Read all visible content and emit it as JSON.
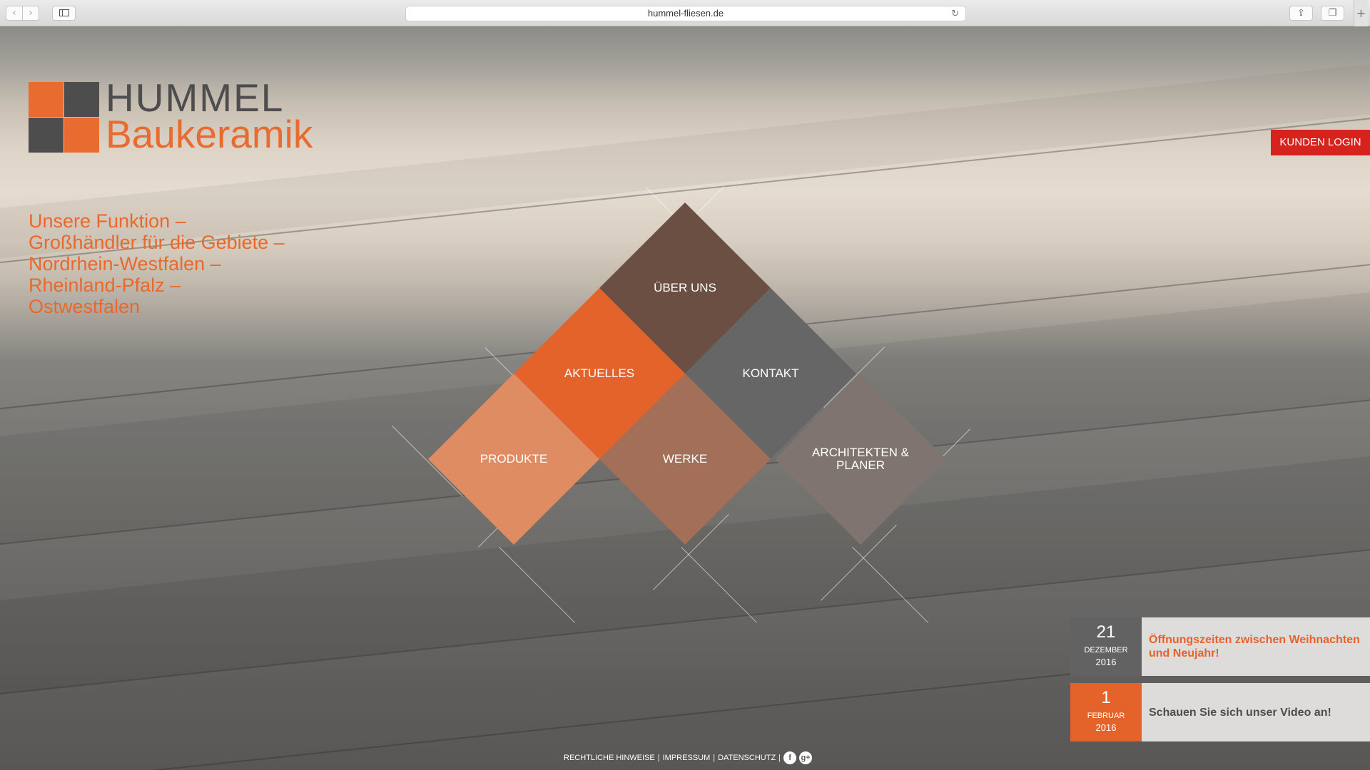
{
  "browser": {
    "url": "hummel-fliesen.de",
    "back_icon": "chevron-left-icon",
    "forward_icon": "chevron-right-icon",
    "back_glyph": "‹",
    "forward_glyph": "›",
    "reload_glyph": "↻",
    "share_glyph": "⇪",
    "tabs_glyph": "❐",
    "new_tab_glyph": "+"
  },
  "logo": {
    "line1": "HUMMEL",
    "line2": "Baukeramik",
    "colors": {
      "orange": "#e86b2f",
      "gray": "#4d4d4d"
    }
  },
  "tagline": [
    "Unsere Funktion –",
    "Großhändler für die Gebiete –",
    "Nordrhein-Westfalen –",
    "Rheinland-Pfalz –",
    "Ostwestfalen"
  ],
  "login": {
    "label": "KUNDEN LOGIN",
    "color": "#d6231e"
  },
  "nav": [
    {
      "label": "ÜBER UNS",
      "color": "#6b4f42"
    },
    {
      "label": "AKTUELLES",
      "color": "#e4632a"
    },
    {
      "label": "KONTAKT",
      "color": "#676666"
    },
    {
      "label": "PRODUKTE",
      "color": "#e08c62"
    },
    {
      "label": "WERKE",
      "color": "#a46f59"
    },
    {
      "label": "ARCHITEKTEN & PLANER",
      "color": "#7f7470"
    }
  ],
  "news": [
    {
      "day": "21",
      "month": "DEZEMBER",
      "year": "2016",
      "title": "Öffnungszeiten zwischen Weihnachten und Neujahr!",
      "date_color": "#636262",
      "title_color": "#e4632a"
    },
    {
      "day": "1",
      "month": "FEBRUAR",
      "year": "2016",
      "title": "Schauen Sie sich unser Video an!",
      "date_color": "#e4632a",
      "title_color": "#4e4d4c"
    }
  ],
  "footer": {
    "links": [
      "RECHTLICHE HINWEISE",
      "IMPRESSUM",
      "DATENSCHUTZ"
    ],
    "separator": "|",
    "facebook_icon": "facebook-icon",
    "google_plus_icon": "google-plus-icon",
    "facebook_glyph": "f",
    "google_plus_glyph": "g+"
  }
}
